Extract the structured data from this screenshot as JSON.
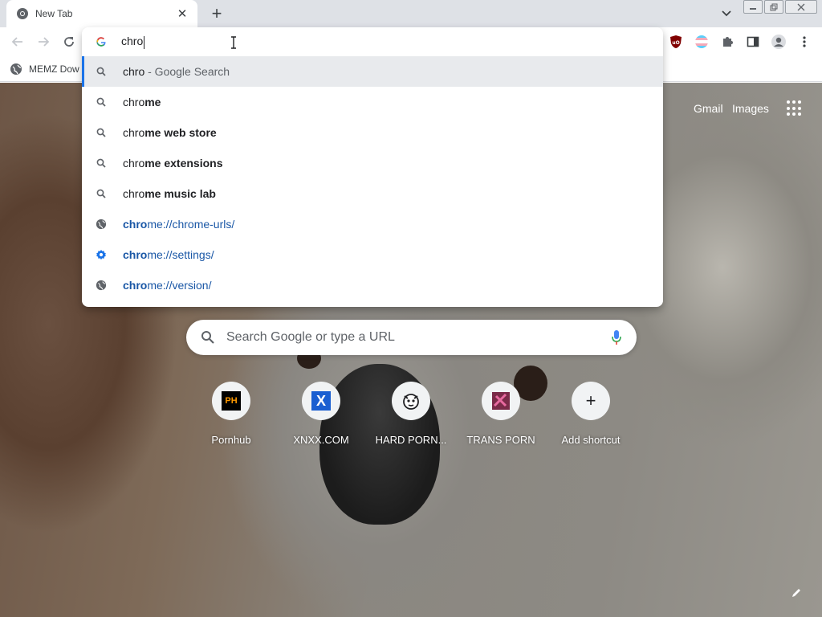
{
  "tab": {
    "title": "New Tab",
    "close_glyph": "✕"
  },
  "new_tab_glyph": "+",
  "omnibox": {
    "typed": "chro",
    "suggestions": [
      {
        "kind": "search",
        "match": "chro",
        "rest": "",
        "suffix": " - Google Search"
      },
      {
        "kind": "search",
        "match": "chro",
        "rest": "me",
        "suffix": ""
      },
      {
        "kind": "search",
        "match": "chro",
        "rest": "me web store",
        "suffix": ""
      },
      {
        "kind": "search",
        "match": "chro",
        "rest": "me extensions",
        "suffix": ""
      },
      {
        "kind": "search",
        "match": "chro",
        "rest": "me music lab",
        "suffix": ""
      },
      {
        "kind": "url",
        "icon": "globe-icon",
        "match": "chro",
        "rest": "me://chrome-urls/"
      },
      {
        "kind": "url",
        "icon": "settings-gear-icon",
        "match": "chro",
        "rest": "me://settings/"
      },
      {
        "kind": "url",
        "icon": "globe-icon",
        "match": "chro",
        "rest": "me://version/"
      }
    ]
  },
  "bookmarks": [
    {
      "label": "MEMZ Dow"
    }
  ],
  "ntp": {
    "gmail": "Gmail",
    "images": "Images",
    "search_placeholder": "Search Google or type a URL",
    "shortcuts": [
      {
        "label": "Pornhub",
        "icon_text": "PH"
      },
      {
        "label": "XNXX.COM",
        "icon_text": "X"
      },
      {
        "label": "HARD PORN...",
        "icon_text": ""
      },
      {
        "label": "TRANS PORN",
        "icon_text": ""
      },
      {
        "label": "Add shortcut",
        "icon_text": "+"
      }
    ]
  },
  "colors": {
    "accent": "#1a73e8",
    "url_text": "#1a57a6",
    "tabstrip": "#dee1e6",
    "ublock": "#800000"
  }
}
